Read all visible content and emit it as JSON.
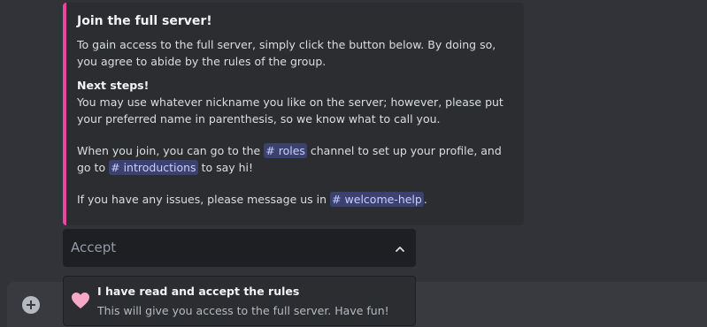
{
  "embed": {
    "accent_color": "#eb459f",
    "title": "Join the full server!",
    "intro": "To gain access to the full server, simply click the button below. By doing so, you agree to abide by the rules of the group.",
    "next_steps_heading": "Next steps!",
    "nickname_text": "You may use whatever nickname you like on the server; however, please put your preferred name in parenthesis, so we know what to call you.",
    "join_text_before": "When you join, you can go to the",
    "roles_channel": "roles",
    "join_text_middle": "channel to set up your profile, and go to",
    "introductions_channel": "introductions",
    "join_text_after": "to say hi!",
    "issues_text_before": "If you have any issues, please message us in",
    "welcome_help_channel": "welcome-help",
    "issues_text_after": "."
  },
  "select": {
    "placeholder": "Accept",
    "expanded": true
  },
  "option": {
    "icon": "pink-heart-icon",
    "label": "I have read and accept the rules",
    "description": "This will give you access to the full server. Have fun!"
  },
  "composer": {
    "add_icon": "plus-circle-icon"
  }
}
